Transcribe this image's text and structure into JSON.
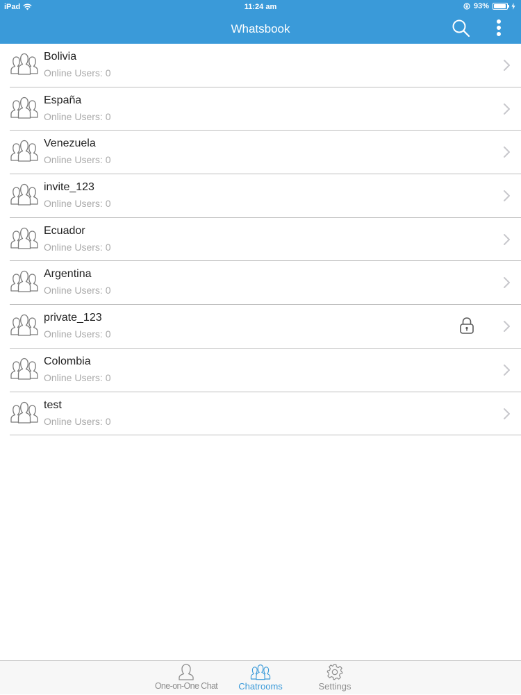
{
  "status_bar": {
    "device": "iPad",
    "time": "11:24 am",
    "battery": "93%",
    "battery_level": 0.93
  },
  "nav": {
    "title": "Whatsbook",
    "search_icon": "search-icon",
    "more_icon": "more-vertical-icon"
  },
  "rooms": [
    {
      "name": "Bolivia",
      "subtitle": "Online Users: 0",
      "locked": false
    },
    {
      "name": "España",
      "subtitle": "Online Users: 0",
      "locked": false
    },
    {
      "name": "Venezuela",
      "subtitle": "Online Users: 0",
      "locked": false
    },
    {
      "name": "invite_123",
      "subtitle": "Online Users: 0",
      "locked": false
    },
    {
      "name": "Ecuador",
      "subtitle": "Online Users: 0",
      "locked": false
    },
    {
      "name": "Argentina",
      "subtitle": "Online Users: 0",
      "locked": false
    },
    {
      "name": "private_123",
      "subtitle": "Online Users: 0",
      "locked": true
    },
    {
      "name": "Colombia",
      "subtitle": "Online Users: 0",
      "locked": false
    },
    {
      "name": "test",
      "subtitle": "Online Users: 0",
      "locked": false
    }
  ],
  "tabs": [
    {
      "label": "One-on-One Chat",
      "icon": "person-icon",
      "active": false
    },
    {
      "label": "Chatrooms",
      "icon": "group-icon",
      "active": true
    },
    {
      "label": "Settings",
      "icon": "gear-icon",
      "active": false
    }
  ],
  "colors": {
    "accent": "#3a9ad9",
    "subtitle": "#a9a9a9",
    "inactive_tab": "#8e8e8e"
  }
}
